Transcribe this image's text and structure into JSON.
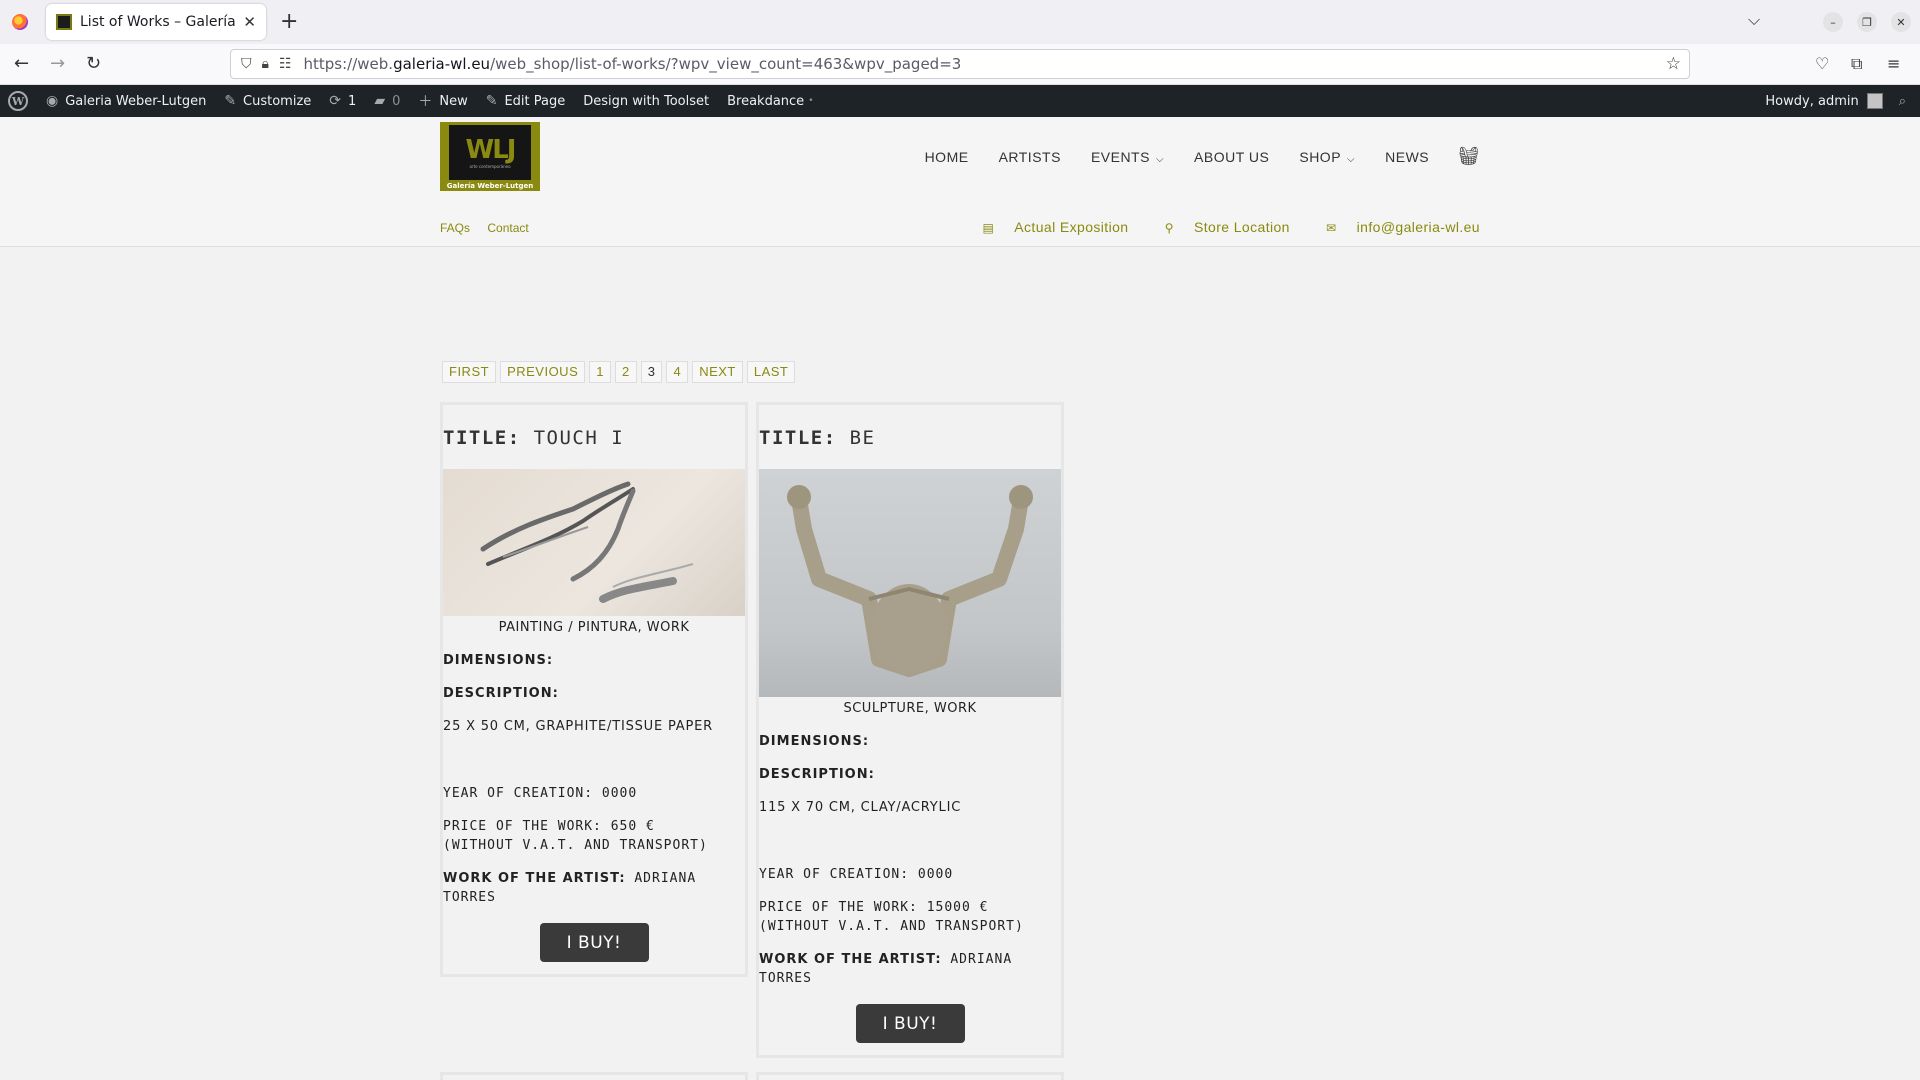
{
  "browser": {
    "tab_title": "List of Works – Galería Weber-Lutgen",
    "url_prefix": "https://web.",
    "url_domain": "galeria-wl.eu",
    "url_path": "/web_shop/list-of-works/?wpv_view_count=463&wpv_paged=3"
  },
  "adminbar": {
    "site": "Galeria Weber-Lutgen",
    "customize": "Customize",
    "updates": "1",
    "comments": "0",
    "new": "New",
    "edit_page": "Edit Page",
    "toolset": "Design with Toolset",
    "breakdance": "Breakdance",
    "breakdance_dot": "•",
    "howdy": "Howdy, admin"
  },
  "logo": {
    "mark": "WLJ",
    "tagline": "arte contemporáneo",
    "name": "Galería Weber-Lutgen"
  },
  "nav": {
    "home": "HOME",
    "artists": "ARTISTS",
    "events": "EVENTS",
    "about": "ABOUT US",
    "shop": "SHOP",
    "news": "NEWS"
  },
  "subnav": {
    "faqs": "FAQs",
    "contact": "Contact",
    "exposition": "Actual Exposition",
    "store": "Store Location",
    "email": "info@galeria-wl.eu"
  },
  "pagination": {
    "first": "FIRST",
    "previous": "PREVIOUS",
    "pages": [
      "1",
      "2",
      "3",
      "4"
    ],
    "current": "3",
    "next": "NEXT",
    "last": "LAST"
  },
  "works": [
    {
      "title_label": "TITLE:",
      "title": "TOUCH I",
      "category": "PAINTING / PINTURA, WORK",
      "dimensions_label": "DIMENSIONS:",
      "description_label": "DESCRIPTION:",
      "description": "25 X 50 CM, GRAPHITE/TISSUE PAPER",
      "year": "YEAR OF CREATION: 0000",
      "price": "PRICE OF THE WORK: 650 € (WITHOUT V.A.T. AND TRANSPORT)",
      "artist_label": "WORK OF THE ARTIST:",
      "artist": "ADRIANA TORRES",
      "buy": "I BUY!"
    },
    {
      "title_label": "TITLE:",
      "title": "BE",
      "category": "SCULPTURE, WORK",
      "dimensions_label": "DIMENSIONS:",
      "description_label": "DESCRIPTION:",
      "description": "115 X 70 CM, CLAY/ACRYLIC",
      "year": "YEAR OF CREATION: 0000",
      "price": "PRICE OF THE WORK: 15000 € (WITHOUT V.A.T. AND TRANSPORT)",
      "artist_label": "WORK OF THE ARTIST:",
      "artist": "ADRIANA TORRES",
      "buy": "I BUY!"
    }
  ],
  "colors": {
    "accent": "#8a8a10",
    "adminbar": "#1d2327",
    "button": "#3a3a3a"
  }
}
